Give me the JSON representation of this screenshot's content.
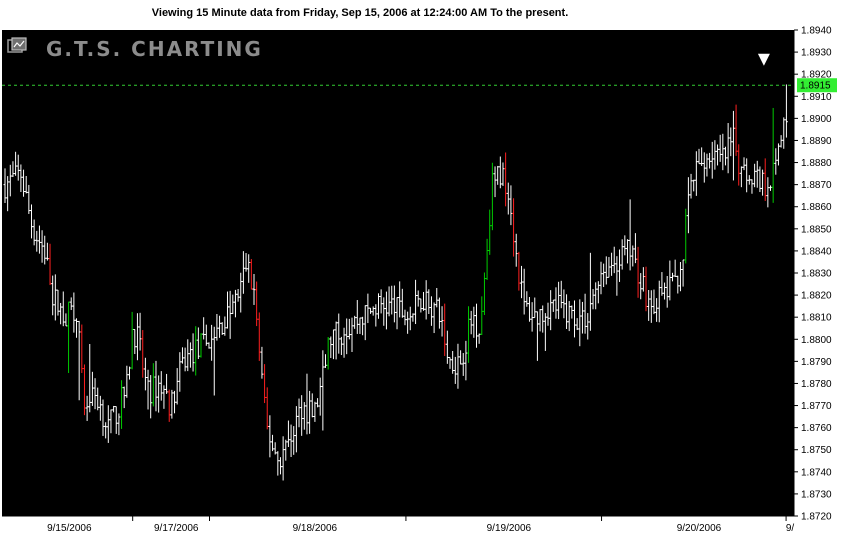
{
  "header": {
    "title": "Viewing 15 Minute  data from Friday, Sep 15, 2006 at 12:24:00 AM To the present."
  },
  "logo": {
    "text": "G.T.S. CHARTING",
    "icon": "chart-window-icon"
  },
  "colors": {
    "background": "#000000",
    "up_bar": "#ffffff",
    "down_bar": "#ff2020",
    "reversal_bar": "#00cc00",
    "current_price_line": "#33cc33",
    "current_price_tag": "#33ee33",
    "marker": "#ffffff"
  },
  "chart_data": {
    "type": "ohlc",
    "interval": "15 Minute",
    "current_price": "1.8915",
    "ylim": [
      1.872,
      1.894
    ],
    "y_ticks": [
      "1.8720",
      "1.8730",
      "1.8740",
      "1.8750",
      "1.8760",
      "1.8770",
      "1.8780",
      "1.8790",
      "1.8800",
      "1.8810",
      "1.8820",
      "1.8830",
      "1.8840",
      "1.8850",
      "1.8860",
      "1.8870",
      "1.8880",
      "1.8890",
      "1.8900",
      "1.8910",
      "1.8920",
      "1.8930",
      "1.8940"
    ],
    "x_labels": [
      {
        "label": "9/15/2006",
        "pos": 0.085
      },
      {
        "label": "9/17/2006",
        "pos": 0.22
      },
      {
        "label": "9/18/2006",
        "pos": 0.395
      },
      {
        "label": "9/19/2006",
        "pos": 0.64
      },
      {
        "label": "9/20/2006",
        "pos": 0.88
      },
      {
        "label": "9/",
        "pos": 0.995
      }
    ],
    "x_separators": [
      0.165,
      0.262,
      0.51,
      0.757,
      0.99
    ],
    "price_path": [
      [
        0.0,
        1.887
      ],
      [
        0.02,
        1.8875
      ],
      [
        0.035,
        1.885
      ],
      [
        0.05,
        1.884
      ],
      [
        0.06,
        1.882
      ],
      [
        0.075,
        1.881
      ],
      [
        0.09,
        1.8815
      ],
      [
        0.1,
        1.877
      ],
      [
        0.115,
        1.8775
      ],
      [
        0.13,
        1.876
      ],
      [
        0.145,
        1.877
      ],
      [
        0.155,
        1.878
      ],
      [
        0.16,
        1.8805
      ],
      [
        0.168,
        1.88
      ],
      [
        0.18,
        1.8775
      ],
      [
        0.195,
        1.878
      ],
      [
        0.21,
        1.877
      ],
      [
        0.225,
        1.879
      ],
      [
        0.24,
        1.8795
      ],
      [
        0.26,
        1.88
      ],
      [
        0.28,
        1.881
      ],
      [
        0.295,
        1.882
      ],
      [
        0.305,
        1.8835
      ],
      [
        0.315,
        1.882
      ],
      [
        0.322,
        1.879
      ],
      [
        0.33,
        1.876
      ],
      [
        0.345,
        1.8745
      ],
      [
        0.36,
        1.8755
      ],
      [
        0.375,
        1.877
      ],
      [
        0.39,
        1.8765
      ],
      [
        0.4,
        1.878
      ],
      [
        0.41,
        1.88
      ],
      [
        0.43,
        1.8805
      ],
      [
        0.45,
        1.881
      ],
      [
        0.47,
        1.8815
      ],
      [
        0.49,
        1.8815
      ],
      [
        0.51,
        1.881
      ],
      [
        0.53,
        1.882
      ],
      [
        0.55,
        1.881
      ],
      [
        0.56,
        1.879
      ],
      [
        0.575,
        1.879
      ],
      [
        0.59,
        1.881
      ],
      [
        0.6,
        1.8805
      ],
      [
        0.615,
        1.887
      ],
      [
        0.625,
        1.8875
      ],
      [
        0.635,
        1.887
      ],
      [
        0.645,
        1.884
      ],
      [
        0.655,
        1.8815
      ],
      [
        0.67,
        1.881
      ],
      [
        0.685,
        1.8815
      ],
      [
        0.7,
        1.8815
      ],
      [
        0.72,
        1.881
      ],
      [
        0.735,
        1.881
      ],
      [
        0.75,
        1.883
      ],
      [
        0.77,
        1.8835
      ],
      [
        0.79,
        1.884
      ],
      [
        0.805,
        1.8825
      ],
      [
        0.815,
        1.8815
      ],
      [
        0.83,
        1.882
      ],
      [
        0.845,
        1.8825
      ],
      [
        0.855,
        1.8835
      ],
      [
        0.865,
        1.887
      ],
      [
        0.88,
        1.888
      ],
      [
        0.895,
        1.8885
      ],
      [
        0.905,
        1.888
      ],
      [
        0.92,
        1.889
      ],
      [
        0.93,
        1.8875
      ],
      [
        0.945,
        1.8875
      ],
      [
        0.96,
        1.887
      ],
      [
        0.975,
        1.888
      ],
      [
        0.985,
        1.89
      ],
      [
        0.995,
        1.8915
      ]
    ]
  }
}
